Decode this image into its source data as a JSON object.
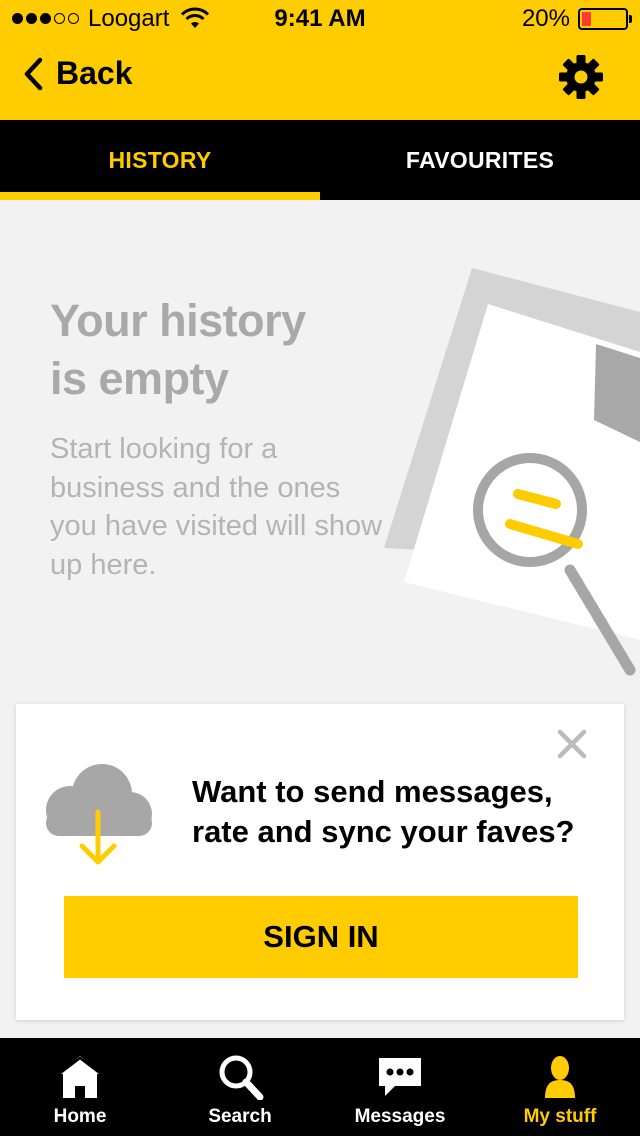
{
  "status_bar": {
    "carrier": "Loogart",
    "time": "9:41 AM",
    "battery_percent": "20%",
    "battery_level": 0.2,
    "signal_bars_filled": 3,
    "signal_bars_total": 5
  },
  "nav": {
    "back_label": "Back",
    "settings_icon": "gear-icon",
    "accent_color": "#ffcc00"
  },
  "tabs": [
    {
      "label": "HISTORY",
      "active": true
    },
    {
      "label": "FAVOURITES",
      "active": false
    }
  ],
  "empty_state": {
    "title_line1": "Your history",
    "title_line2": "is empty",
    "description": "Start looking for a business and the ones you have visited will show up here.",
    "illustration_icon": "document-magnifier-icon"
  },
  "signin_card": {
    "message_line1": "Want to send messages,",
    "message_line2": "rate and sync your faves?",
    "button_label": "SIGN IN",
    "icon": "cloud-download-icon",
    "close_icon": "close-icon"
  },
  "tabbar": [
    {
      "label": "Home",
      "icon": "home-icon",
      "active": false
    },
    {
      "label": "Search",
      "icon": "search-icon",
      "active": false
    },
    {
      "label": "Messages",
      "icon": "messages-icon",
      "active": false
    },
    {
      "label": "My stuff",
      "icon": "user-icon",
      "active": true
    }
  ]
}
